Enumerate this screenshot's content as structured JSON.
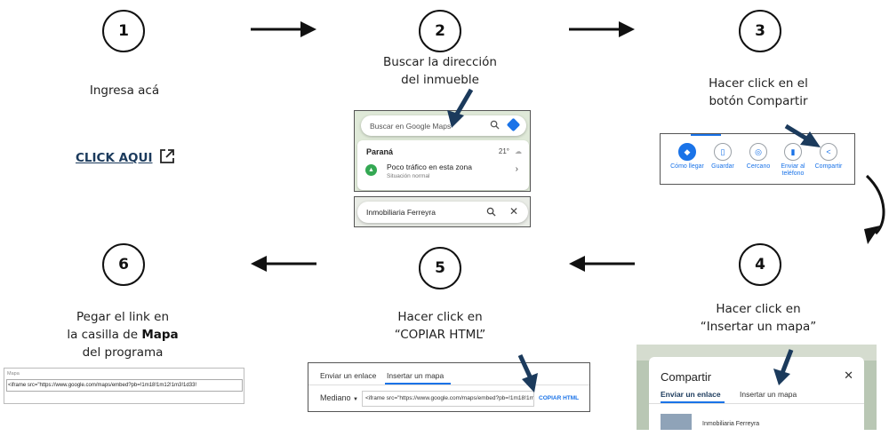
{
  "steps": [
    {
      "number": "1",
      "caption_lines": [
        "Ingresa acá"
      ]
    },
    {
      "number": "2",
      "caption_lines": [
        "Buscar la dirección",
        "del inmueble"
      ]
    },
    {
      "number": "3",
      "caption_lines": [
        "Hacer click en el",
        "botón Compartir"
      ]
    },
    {
      "number": "4",
      "caption_lines": [
        "Hacer click en",
        "“Insertar un mapa”"
      ]
    },
    {
      "number": "5",
      "caption_lines": [
        "Hacer click en",
        "“COPIAR HTML”"
      ]
    },
    {
      "number": "6",
      "caption_lines": [
        "Pegar el link en",
        "la casilla de",
        "Mapa",
        "del programa"
      ]
    }
  ],
  "click_link": {
    "label": "CLICK AQUI",
    "icon": "external-link-icon"
  },
  "step2_shot": {
    "search_placeholder": "Buscar en Google Maps",
    "city": "Paraná",
    "temperature": "21°",
    "traffic_title": "Poco tráfico en esta zona",
    "traffic_sub": "Situación normal",
    "search2_value": "Inmobiliaria Ferreyra"
  },
  "step3_shot": {
    "actions": [
      {
        "label": "Cómo llegar",
        "icon": "directions-icon"
      },
      {
        "label": "Guardar",
        "icon": "bookmark-icon"
      },
      {
        "label": "Cercano",
        "icon": "nearby-icon"
      },
      {
        "label": "Enviar al teléfono",
        "icon": "phone-icon"
      },
      {
        "label": "Compartir",
        "icon": "share-icon"
      }
    ]
  },
  "step4_shot": {
    "title": "Compartir",
    "tab1": "Enviar un enlace",
    "tab2": "Insertar un mapa",
    "place": "Inmobiliaria Ferreyra"
  },
  "step5_shot": {
    "tab1": "Enviar un enlace",
    "tab2": "Insertar un mapa",
    "size": "Mediano",
    "code": "<iframe src=\"https://www.google.com/maps/embed?pb=!1m18!1m",
    "copy": "COPIAR HTML"
  },
  "step6_shot": {
    "field_label": "Mapa",
    "field_value": "<iframe src=\"https://www.google.com/maps/embed?pb=!1m18!1m12!1m3!1d33!"
  },
  "colors": {
    "accent_arrow": "#1b3a5c",
    "link": "#1b3a5c",
    "maps_blue": "#1a73e8",
    "flow_arrow": "#111111"
  }
}
